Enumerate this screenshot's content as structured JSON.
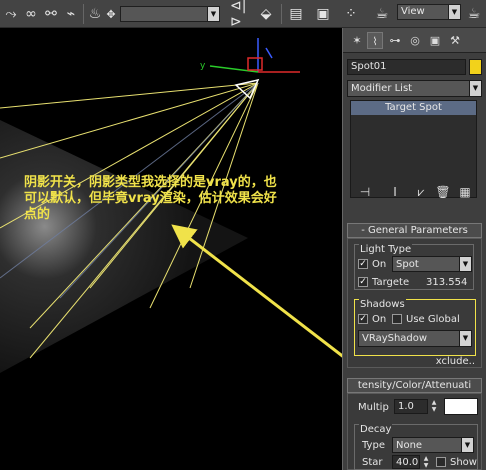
{
  "toolbar": {
    "icons": [
      "link-icon",
      "chain-icon",
      "unlink-icon",
      "bind-icon",
      "teapot-select-icon",
      "spinner-icon",
      "abc-icon",
      "mirror-icon",
      "align-icon",
      "layer-manager-icon",
      "curve-editor-icon",
      "schematic-icon",
      "material-editor-icon",
      "render-setup-icon",
      "render-icon"
    ],
    "named_selection_value": "",
    "view_dropdown_value": "View"
  },
  "viewport": {
    "annotation_line1": "阴影开关，阴影类型我选择的是vray的，也",
    "annotation_line2": "可以默认，但毕竟vray渲染，估计效果会好",
    "annotation_line3": "点的",
    "gizmo_label": "y",
    "accent_yellow": "#f0e24a",
    "light_beam_color": "#e8e070"
  },
  "panel": {
    "object_name": "Spot01",
    "object_color": "#f2d21b",
    "modifier_list": "Modifier List",
    "stack_item": "Target Spot",
    "general_params_title": "- General Parameters",
    "light_type_group": "Light Type",
    "light_on_label": "On",
    "light_type_value": "Spot",
    "targeted_label": "Targete",
    "target_distance": "313.554",
    "shadows_group": "Shadows",
    "shadows_on_label": "On",
    "use_global_label": "Use Global",
    "shadow_type_value": "VRayShadow",
    "exclude_button": "xclude..",
    "intensity_title": "tensity/Color/Attenuati",
    "multiplier_label": "Multip",
    "multiplier_value": "1.0",
    "light_color": "#ffffff",
    "decay_group": "Decay",
    "decay_type_label": "Type",
    "decay_type_value": "None",
    "decay_start_label": "Star",
    "decay_start_value": "40.0",
    "decay_show_label": "Show"
  }
}
